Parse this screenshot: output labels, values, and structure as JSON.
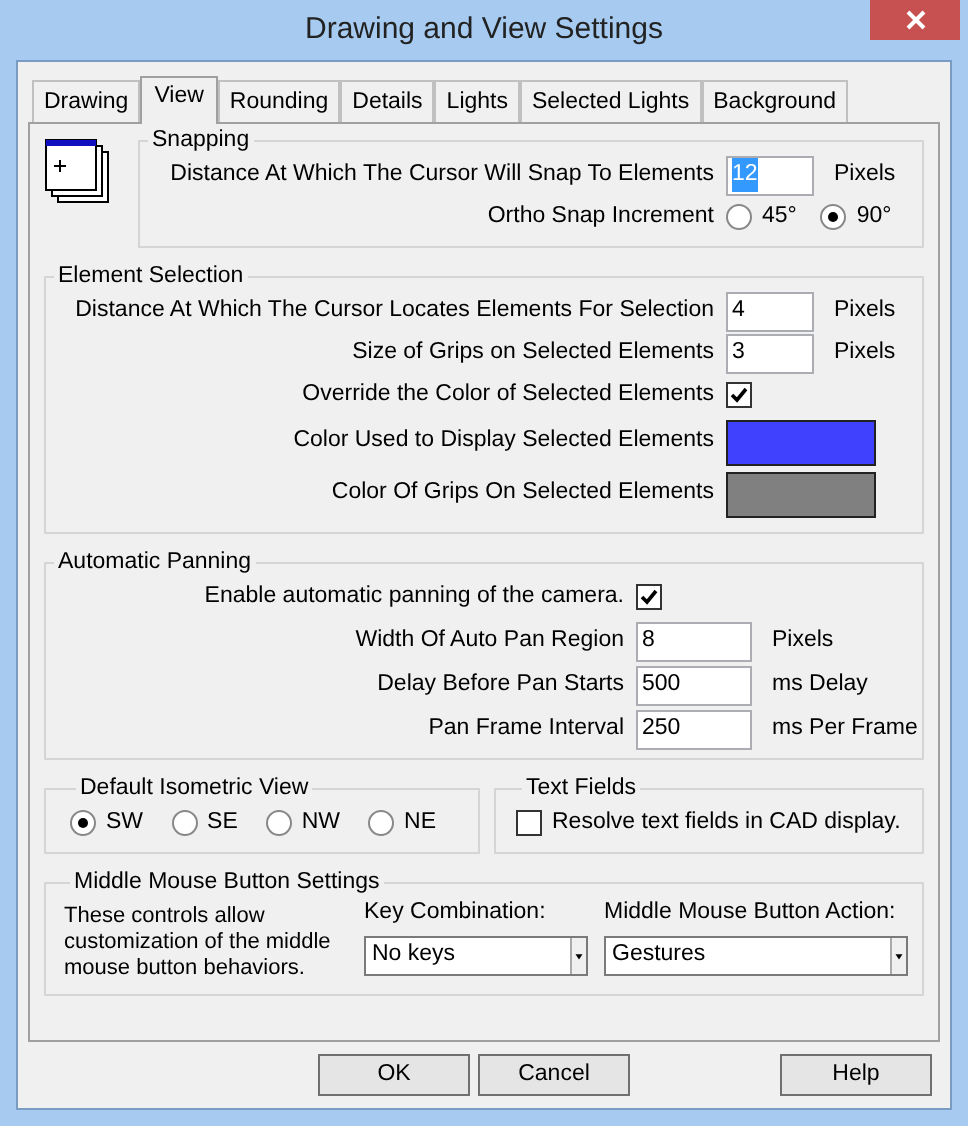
{
  "window": {
    "title": "Drawing and View Settings"
  },
  "tabs": [
    {
      "label": "Drawing",
      "selected": false
    },
    {
      "label": "View",
      "selected": true
    },
    {
      "label": "Rounding",
      "selected": false
    },
    {
      "label": "Details",
      "selected": false
    },
    {
      "label": "Lights",
      "selected": false
    },
    {
      "label": "Selected Lights",
      "selected": false
    },
    {
      "label": "Background",
      "selected": false
    }
  ],
  "snapping": {
    "title": "Snapping",
    "rows": [
      {
        "kind": "field",
        "label": "Distance At Which The Cursor Will Snap To Elements",
        "value": "12",
        "text_selected": true,
        "unit": "Pixels"
      },
      {
        "kind": "radios",
        "label": "Ortho Snap Increment",
        "options": [
          {
            "label": "45°",
            "selected": false
          },
          {
            "label": "90°",
            "selected": true
          }
        ]
      }
    ]
  },
  "element_selection": {
    "title": "Element Selection",
    "rows": [
      {
        "kind": "field",
        "label": "Distance At Which The Cursor Locates Elements For Selection",
        "value": "4",
        "text_selected": false,
        "unit": "Pixels"
      },
      {
        "kind": "field",
        "label": "Size of Grips on Selected Elements",
        "value": "3",
        "text_selected": false,
        "unit": "Pixels"
      },
      {
        "kind": "checkbox",
        "label": "Override the Color of Selected Elements",
        "checked": true
      },
      {
        "kind": "color",
        "label": "Color Used to Display Selected Elements",
        "color": "#4040ff"
      },
      {
        "kind": "color",
        "label": "Color Of Grips On Selected Elements",
        "color": "#808080"
      }
    ]
  },
  "automatic_panning": {
    "title": "Automatic Panning",
    "rows": [
      {
        "kind": "checkbox",
        "label": "Enable automatic panning of the camera.",
        "checked": true
      },
      {
        "kind": "field",
        "label": "Width Of Auto Pan Region",
        "value": "8",
        "text_selected": false,
        "unit": "Pixels"
      },
      {
        "kind": "field",
        "label": "Delay Before Pan Starts",
        "value": "500",
        "text_selected": false,
        "unit": "ms Delay"
      },
      {
        "kind": "field",
        "label": "Pan Frame Interval",
        "value": "250",
        "text_selected": false,
        "unit": "ms Per Frame"
      }
    ]
  },
  "default_isometric_view": {
    "title": "Default Isometric View",
    "options": [
      {
        "label": "SW",
        "selected": true
      },
      {
        "label": "SE",
        "selected": false
      },
      {
        "label": "NW",
        "selected": false
      },
      {
        "label": "NE",
        "selected": false
      }
    ]
  },
  "text_fields": {
    "title": "Text Fields",
    "checkbox": {
      "label": "Resolve text fields in CAD display.",
      "checked": false
    }
  },
  "middle_mouse": {
    "title": "Middle Mouse Button Settings",
    "description": "These controls allow customization of the middle mouse button behaviors.",
    "key_combination": {
      "label": "Key Combination:",
      "value": "No keys"
    },
    "action": {
      "label": "Middle Mouse Button Action:",
      "value": "Gestures"
    }
  },
  "buttons": [
    "OK",
    "Cancel",
    "Help"
  ]
}
